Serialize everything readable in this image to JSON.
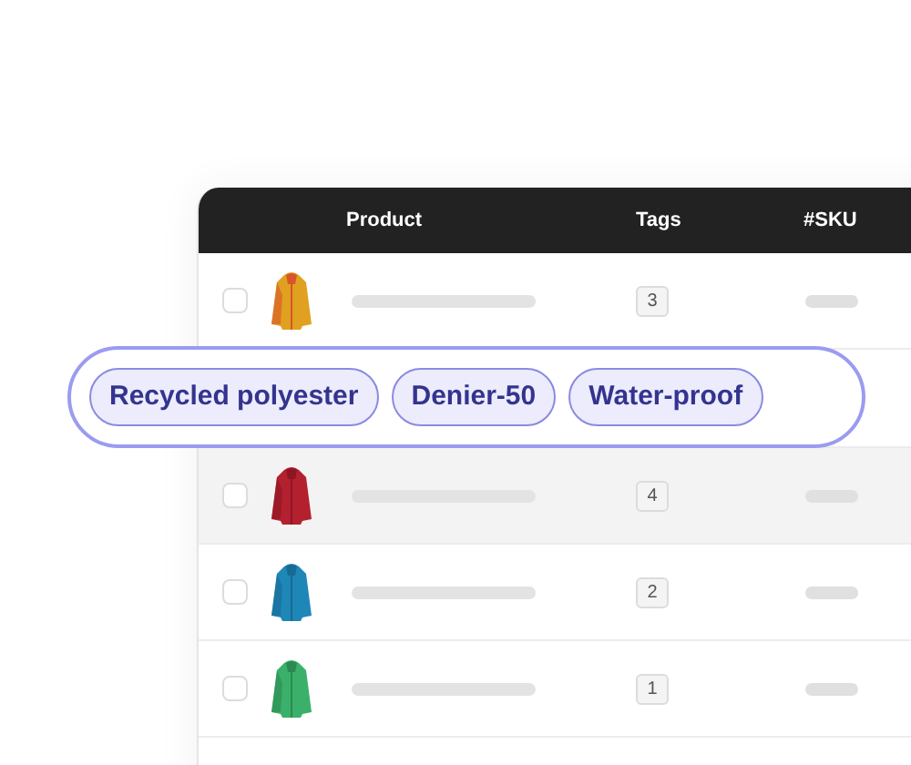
{
  "table": {
    "columns": [
      "Product",
      "Tags",
      "#SKU"
    ],
    "rows": [
      {
        "checked": false,
        "highlighted": false,
        "tag_count": "3"
      },
      {
        "checked": false,
        "highlighted": true,
        "tag_count": "4"
      },
      {
        "checked": false,
        "highlighted": false,
        "tag_count": "2"
      },
      {
        "checked": false,
        "highlighted": false,
        "tag_count": "1"
      }
    ]
  },
  "tag_popup": {
    "tags": [
      "Recycled polyester",
      "Denier-50",
      "Water-proof"
    ]
  }
}
